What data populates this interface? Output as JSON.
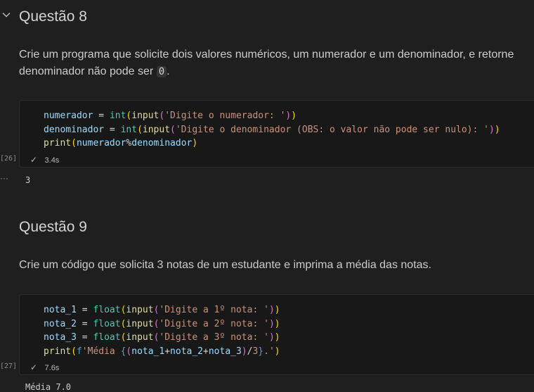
{
  "q8": {
    "heading": "Questão 8",
    "para_line1": "Crie um programa que solicite dois valores numéricos, um numerador e um denominador, e retorne",
    "para_line2_prefix": "denominador não pode ser ",
    "para_line2_code": "0",
    "para_line2_suffix": ".",
    "code_lines": [
      "numerador = int(input('Digite o numerador: '))",
      "denominador = int(input('Digite o denominador (OBS: o valor não pode ser nulo): '))",
      "print(numerador%denominador)"
    ],
    "exec_count": "[26]",
    "check_icon": "check-icon",
    "duration": "3.4s",
    "output_menu": "···",
    "output": "3"
  },
  "q9": {
    "heading": "Questão 9",
    "para": "Crie um código que solicita 3 notas de um estudante e imprima a média das notas.",
    "code_lines": [
      "nota_1 = float(input('Digite a 1º nota: '))",
      "nota_2 = float(input('Digite a 2º nota: '))",
      "nota_3 = float(input('Digite a 3º nota: '))",
      "print(f'Média {(nota_1+nota_2+nota_3)/3}.')"
    ],
    "exec_count": "[27]",
    "duration": "7.6s",
    "output": "Média 7.0"
  },
  "colors": {
    "background": "#1f1f1f",
    "cell_background": "#181818",
    "check": "#89d185"
  }
}
